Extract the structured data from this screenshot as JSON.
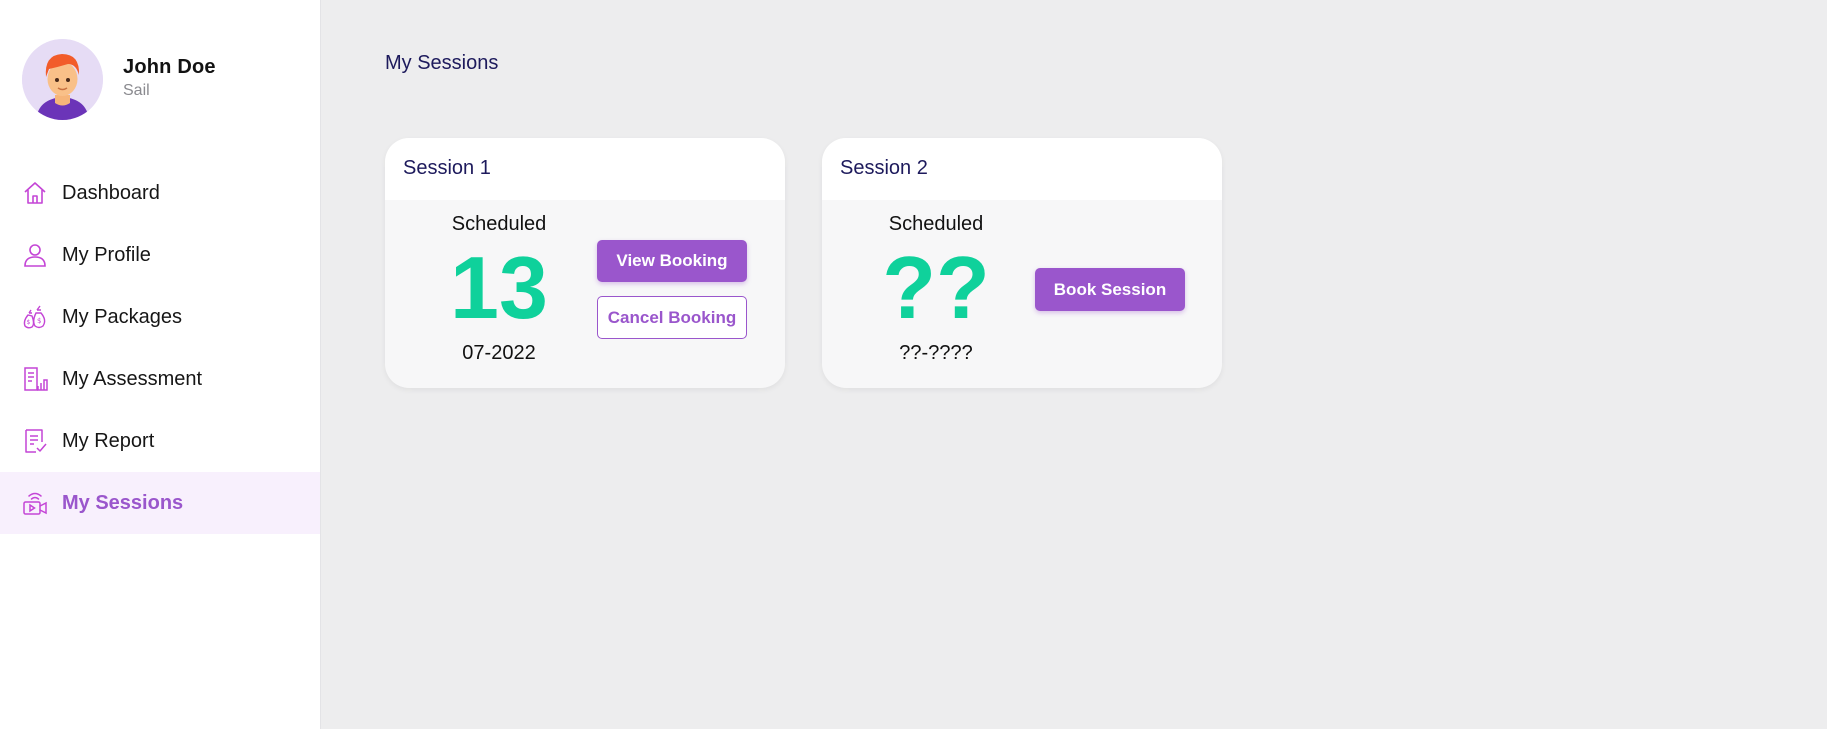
{
  "user": {
    "name": "John Doe",
    "role": "Sail"
  },
  "nav": [
    {
      "label": "Dashboard",
      "icon": "home-icon",
      "active": false
    },
    {
      "label": "My Profile",
      "icon": "user-icon",
      "active": false
    },
    {
      "label": "My Packages",
      "icon": "money-bags-icon",
      "active": false
    },
    {
      "label": "My Assessment",
      "icon": "assessment-chart-icon",
      "active": false
    },
    {
      "label": "My Report",
      "icon": "report-check-icon",
      "active": false
    },
    {
      "label": "My Sessions",
      "icon": "video-session-icon",
      "active": true
    }
  ],
  "page": {
    "title": "My Sessions"
  },
  "sessions": [
    {
      "title": "Session 1",
      "status": "Scheduled",
      "day": "13",
      "month": "07-2022",
      "primary_action": "View Booking",
      "secondary_action": "Cancel Booking"
    },
    {
      "title": "Session 2",
      "status": "Scheduled",
      "day": "??",
      "month": "??-????",
      "primary_action": "Book Session"
    }
  ],
  "colors": {
    "accent": "#9a56cc",
    "date_green": "#0fd19b",
    "title_navy": "#1d1a5c",
    "active_bg": "#f8f0fd",
    "page_bg": "#ededee"
  }
}
